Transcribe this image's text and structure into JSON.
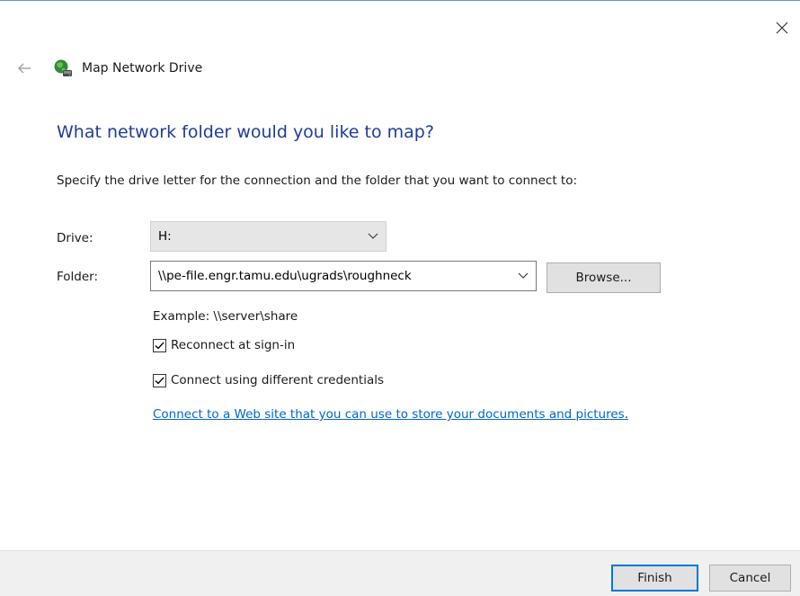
{
  "window": {
    "close_icon": "close-icon"
  },
  "header": {
    "back_icon": "back-arrow-icon",
    "app_icon": "network-drive-icon",
    "title": "Map Network Drive"
  },
  "main": {
    "instruction": "What network folder would you like to map?",
    "description": "Specify the drive letter for the connection and the folder that you want to connect to:"
  },
  "form": {
    "drive_label": "Drive:",
    "drive_value": "H:",
    "folder_label": "Folder:",
    "folder_value": "\\\\pe-file.engr.tamu.edu\\ugrads\\roughneck",
    "browse_label": "Browse...",
    "example": "Example: \\\\server\\share",
    "reconnect_label": "Reconnect at sign-in",
    "reconnect_checked": true,
    "credentials_label": "Connect using different credentials",
    "credentials_checked": true,
    "web_link": "Connect to a Web site that you can use to store your documents and pictures",
    "web_link_suffix": "."
  },
  "footer": {
    "finish_label": "Finish",
    "cancel_label": "Cancel"
  },
  "colors": {
    "accent": "#0078d7",
    "instruction_text": "#1f3d99",
    "link": "#0066cc",
    "footer_bg": "#f0f0f0"
  }
}
